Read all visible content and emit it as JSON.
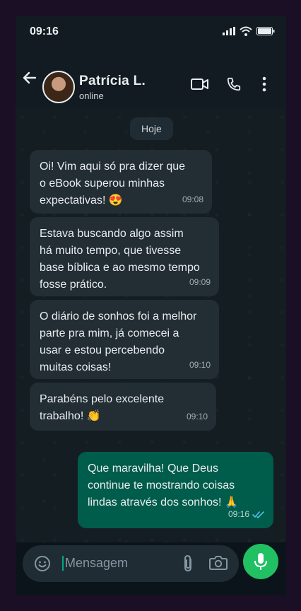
{
  "status_bar": {
    "time": "09:16"
  },
  "header": {
    "contact_name": "Patrícia L.",
    "contact_status": "online"
  },
  "chat": {
    "day_label": "Hoje",
    "messages": [
      {
        "direction": "in",
        "text": "Oi! Vim aqui só pra dizer que\no eBook superou minhas\nexpectativas! 😍",
        "time": "09:08"
      },
      {
        "direction": "in",
        "text": "Estava buscando algo assim\nhá muito tempo, que tivesse\nbase bíblica e ao mesmo tempo\nfosse prático.",
        "time": "09:09"
      },
      {
        "direction": "in",
        "text": "O diário de sonhos foi a melhor\nparte pra mim, já comecei a\nusar e estou percebendo\nmuitas coisas!",
        "time": "09:10"
      },
      {
        "direction": "in",
        "text": "Parabéns pelo excelente\ntrabalho! 👏",
        "time": "09:10"
      },
      {
        "direction": "out",
        "text": "Que maravilha! Que Deus\ncontinue te mostrando coisas\nlindas através dos sonhos! 🙏",
        "time": "09:16",
        "read": true
      }
    ]
  },
  "composer": {
    "placeholder": "Mensagem"
  },
  "colors": {
    "incoming_bubble": "#222d34",
    "outgoing_bubble": "#005c4b",
    "accent": "#21c063",
    "read_ticks": "#53bdeb"
  }
}
